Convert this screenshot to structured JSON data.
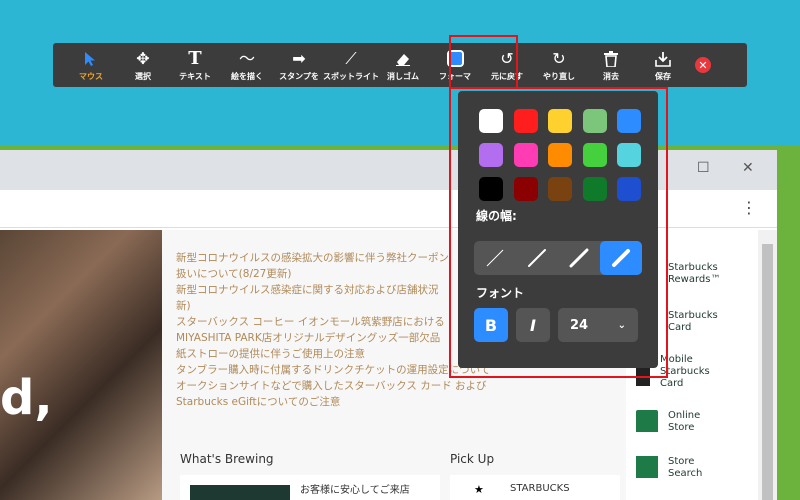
{
  "toolbar": {
    "tools": [
      {
        "label": "マウス",
        "icon": "cursor-icon"
      },
      {
        "label": "選択",
        "icon": "move-icon"
      },
      {
        "label": "テキスト",
        "icon": "text-icon"
      },
      {
        "label": "絵を描く",
        "icon": "draw-icon"
      },
      {
        "label": "スタンプを",
        "icon": "stamp-icon"
      },
      {
        "label": "スポットライト",
        "icon": "spotlight-icon"
      },
      {
        "label": "消しゴム",
        "icon": "eraser-icon"
      },
      {
        "label": "フォーマ",
        "icon": "format-icon"
      },
      {
        "label": "元に戻す",
        "icon": "undo-icon"
      },
      {
        "label": "やり直し",
        "icon": "redo-icon"
      },
      {
        "label": "消去",
        "icon": "trash-icon"
      },
      {
        "label": "保存",
        "icon": "save-icon"
      }
    ],
    "close": "✕"
  },
  "popup": {
    "colors": [
      "#ffffff",
      "#ff1e1e",
      "#ffd12e",
      "#7cc67c",
      "#2d8cff",
      "#b36ef0",
      "#ff3cb4",
      "#ff8c00",
      "#44d13d",
      "#55d4e0",
      "#000000",
      "#8b0000",
      "#7a4210",
      "#0f7a2a",
      "#1d4fd0"
    ],
    "width_label": "線の幅:",
    "font_label": "フォント",
    "bold": "B",
    "italic": "I",
    "font_size": "24",
    "selected_width_index": 3
  },
  "page": {
    "news": [
      "新型コロナウイルスの感染拡大の影響に伴う弊社クーポン",
      "扱いについて(8/27更新)",
      "新型コロナウイルス感染症に関する対応および店舗状況",
      "新)",
      "スターバックス コーヒー イオンモール筑紫野店における",
      "MIYASHITA PARK店オリジナルデザイングッズ一部欠品",
      "紙ストローの提供に伴うご使用上の注意",
      "タンブラー購入時に付属するドリンクチケットの運用設定について",
      "オークションサイトなどで購入したスターバックス カード および",
      "Starbucks eGiftについてのご注意"
    ],
    "hero_text": "d,",
    "whats_brewing": "What's Brewing",
    "pick_up": "Pick Up",
    "brewing_item": "お客様に安心してご来店",
    "pickup_item": "STARBUCKS",
    "sidebar": [
      {
        "label": "Starbucks Rewards™",
        "icon": "star-icon"
      },
      {
        "label": "Starbucks Card",
        "icon": "card-icon"
      },
      {
        "label": "Mobile Starbucks Card",
        "icon": "mobile-card-icon"
      },
      {
        "label": "Online Store",
        "icon": "bag-icon"
      },
      {
        "label": "Store Search",
        "icon": "store-icon"
      }
    ]
  }
}
